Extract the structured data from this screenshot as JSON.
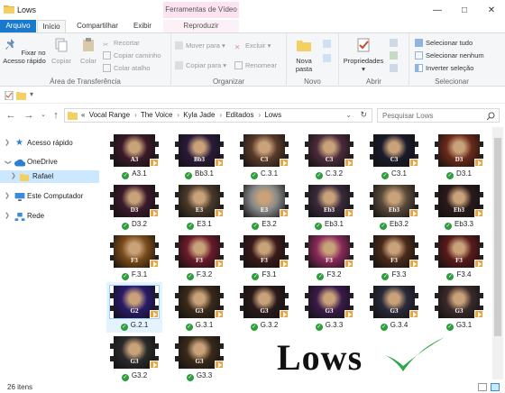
{
  "window": {
    "title": "Lows"
  },
  "ribbon_tabs": {
    "file": "Arquivo",
    "home": "Início",
    "share": "Compartilhar",
    "view": "Exibir"
  },
  "contextual": {
    "header": "Ferramentas de Vídeo",
    "tab": "Reproduzir"
  },
  "ribbon": {
    "clipboard": {
      "label": "Área de Transferência",
      "pin": "Fixar no Acesso rápido",
      "copy": "Copiar",
      "paste": "Colar",
      "cut": "Recortar",
      "copy_path": "Copiar caminho",
      "paste_shortcut": "Colar atalho"
    },
    "organize": {
      "label": "Organizar",
      "move_to": "Mover para",
      "copy_to": "Copiar para",
      "delete": "Excluir",
      "rename": "Renomear"
    },
    "new": {
      "label": "Novo",
      "new_folder": "Nova pasta"
    },
    "open": {
      "label": "Abrir",
      "properties": "Propriedades"
    },
    "select": {
      "label": "Selecionar",
      "select_all": "Selecionar tudo",
      "select_none": "Selecionar nenhum",
      "invert": "Inverter seleção"
    }
  },
  "address": {
    "prefix": "«",
    "crumbs": [
      "Vocal Range",
      "The Voice",
      "Kyla Jade",
      "Editados",
      "Lows"
    ],
    "search_placeholder": "Pesquisar Lows"
  },
  "sidebar": {
    "items": [
      {
        "label": "Acesso rápido"
      },
      {
        "label": "OneDrive"
      },
      {
        "label": "Rafael"
      },
      {
        "label": "Este Computador"
      },
      {
        "label": "Rede"
      }
    ]
  },
  "files": [
    {
      "name": "A3.1",
      "tag": "A3",
      "bg": "#3a1a28"
    },
    {
      "name": "Bb3.1",
      "tag": "Bb3",
      "bg": "#2a1a3a"
    },
    {
      "name": "C.3.1",
      "tag": "C3",
      "bg": "#5a3a2a"
    },
    {
      "name": "C.3.2",
      "tag": "C3",
      "bg": "#4a2a3a"
    },
    {
      "name": "C3.1",
      "tag": "C3",
      "bg": "#1a1a2a"
    },
    {
      "name": "D3.1",
      "tag": "D3",
      "bg": "#6a2a1a"
    },
    {
      "name": "D3.2",
      "tag": "D3",
      "bg": "#3a1a2a"
    },
    {
      "name": "E3.1",
      "tag": "E3",
      "bg": "#4a3a2a"
    },
    {
      "name": "E3.2",
      "tag": "E3",
      "bg": "#8a8a8a"
    },
    {
      "name": "Eb3.1",
      "tag": "Eb3",
      "bg": "#3a2a3a"
    },
    {
      "name": "Eb3.2",
      "tag": "Eb3",
      "bg": "#5a4a3a"
    },
    {
      "name": "Eb3.3",
      "tag": "Eb3",
      "bg": "#2a1a1a"
    },
    {
      "name": "F.3.1",
      "tag": "F3",
      "bg": "#7a4a1a"
    },
    {
      "name": "F.3.2",
      "tag": "F3",
      "bg": "#6a1a2a"
    },
    {
      "name": "F3.1",
      "tag": "F3",
      "bg": "#3a1a1a"
    },
    {
      "name": "F3.2",
      "tag": "F3",
      "bg": "#8a2a5a"
    },
    {
      "name": "F3.3",
      "tag": "F3",
      "bg": "#4a2a1a"
    },
    {
      "name": "F3.4",
      "tag": "F3",
      "bg": "#5a1a1a"
    },
    {
      "name": "G.2.1",
      "tag": "G2",
      "bg": "#2a1a6a"
    },
    {
      "name": "G.3.1",
      "tag": "G3",
      "bg": "#3a2a1a"
    },
    {
      "name": "G.3.2",
      "tag": "G3",
      "bg": "#2a1a1a"
    },
    {
      "name": "G.3.3",
      "tag": "G3",
      "bg": "#3a1a4a"
    },
    {
      "name": "G.3.4",
      "tag": "G3",
      "bg": "#2a2a3a"
    },
    {
      "name": "G3.1",
      "tag": "G3",
      "bg": "#3a2a2a"
    },
    {
      "name": "G3.2",
      "tag": "G3",
      "bg": "#2a2a2a"
    },
    {
      "name": "G3.3",
      "tag": "G3",
      "bg": "#3a2a1a"
    }
  ],
  "overlay": {
    "text": "Lows"
  },
  "status": {
    "count": "26 itens"
  },
  "colors": {
    "accent": "#1979ca",
    "check": "#2e9e3c",
    "overlay_check": "#2ea84a"
  }
}
